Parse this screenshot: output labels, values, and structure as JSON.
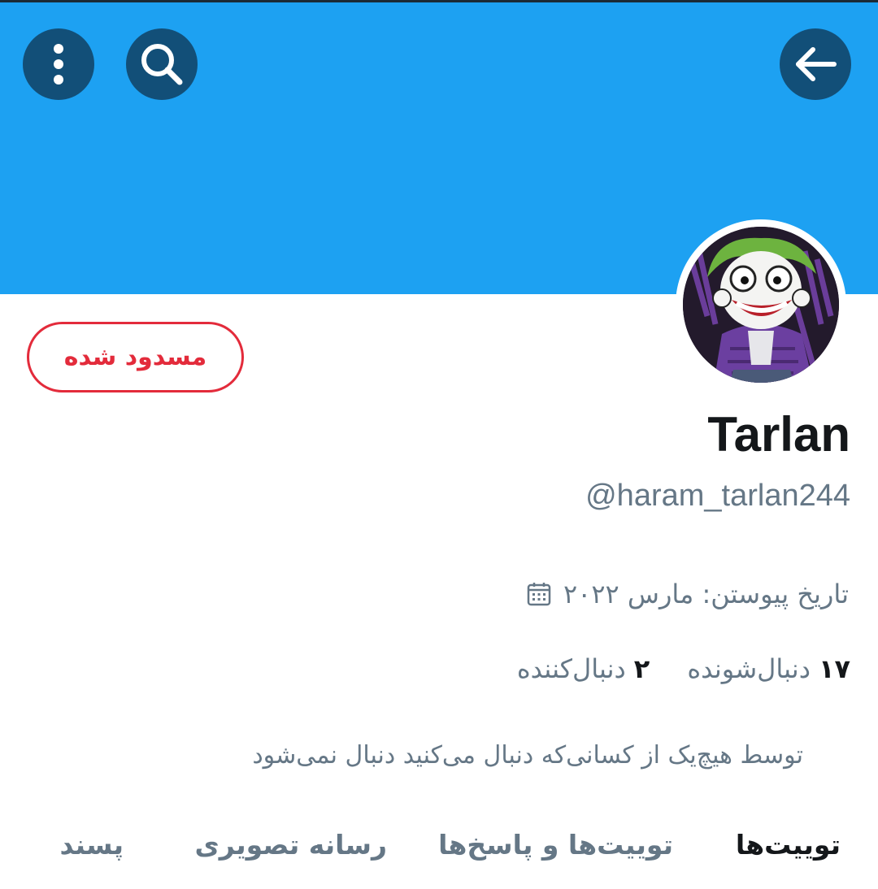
{
  "header": {
    "back_icon": "arrow-left-icon",
    "search_icon": "search-icon",
    "more_icon": "more-vertical-icon"
  },
  "colors": {
    "banner": "#1da1f2",
    "header_buttons": "#124f78",
    "blocked": "#e32b3b",
    "text_primary": "#14171a",
    "text_secondary": "#657786"
  },
  "profile": {
    "display_name": "Tarlan",
    "handle": "@haram_tarlan244",
    "blocked_label": "مسدود شده",
    "joined_icon": "calendar-icon",
    "joined": "تاریخ پیوستن: مارس ۲۰۲۲",
    "following_count": "۱۷",
    "following_label": "دنبال‌شونده",
    "followers_count": "۲",
    "followers_label": "دنبال‌کننده",
    "not_followed_note": "توسط هیچ‌یک از کسانی‌که دنبال می‌کنید دنبال نمی‌شود"
  },
  "tabs": [
    {
      "label": "توییت‌ها",
      "active": true
    },
    {
      "label": "توییت‌ها و پاسخ‌ها",
      "active": false
    },
    {
      "label": "رسانه تصویری",
      "active": false
    },
    {
      "label": "پسند",
      "active": false
    }
  ]
}
